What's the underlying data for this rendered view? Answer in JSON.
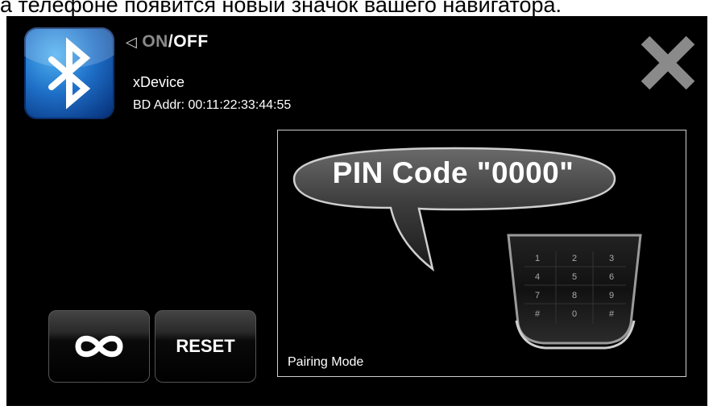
{
  "caption": "а телефоне появится новый значок вашего навигатора.",
  "bluetooth": {
    "icon": "bluetooth-icon",
    "toggle": {
      "arrow": "◁",
      "on": "ON",
      "separator": "/",
      "off": "OFF"
    },
    "device_name": "xDevice",
    "bd_addr": "BD Addr: 00:11:22:33:44:55"
  },
  "close_icon": "close-icon",
  "buttons": {
    "loop_icon": "infinity-icon",
    "reset_label": "RESET"
  },
  "pairing": {
    "pin_text": "PIN Code \"0000\"",
    "mode_label": "Pairing Mode",
    "keypad": [
      "1",
      "2",
      "3",
      "4",
      "5",
      "6",
      "7",
      "8",
      "9",
      "#",
      "0",
      "#"
    ]
  },
  "colors": {
    "screen_bg": "#000000",
    "bluetooth_blue": "#1e6fc7",
    "close_gray": "#8a8a8a"
  }
}
